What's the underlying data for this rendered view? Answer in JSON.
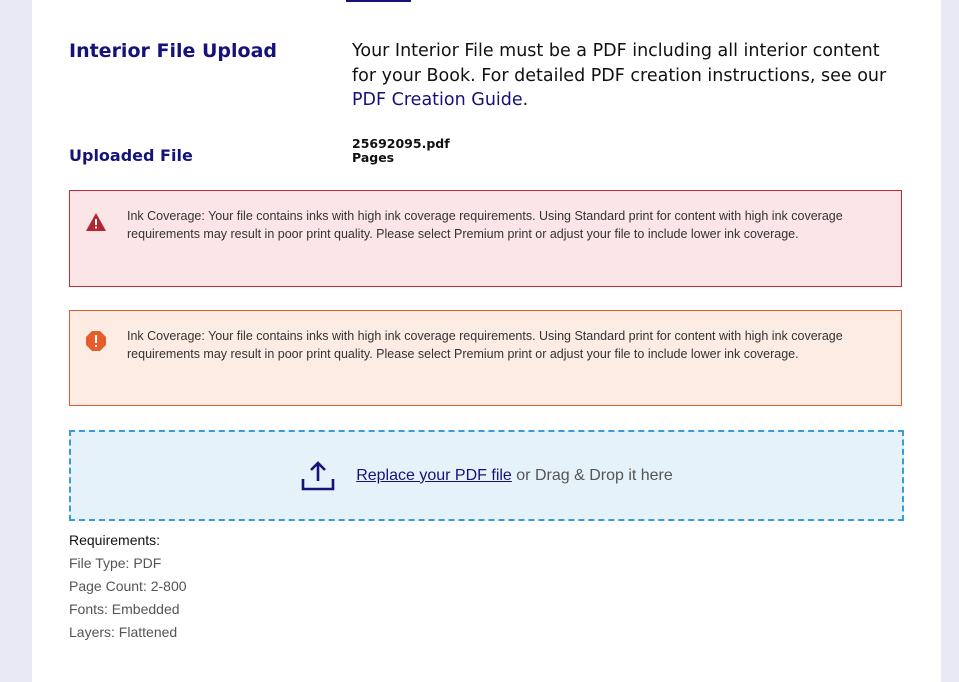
{
  "interior": {
    "heading": "Interior File Upload",
    "intro_text": "Your Interior File must be a PDF including all interior content for your Book. For detailed PDF creation instructions, see our ",
    "guide_link": "PDF Creation Guide",
    "guide_suffix": "."
  },
  "uploaded": {
    "heading": "Uploaded File",
    "filename": "25692095.pdf",
    "pages_label": "Pages"
  },
  "alerts": [
    {
      "severity": "error",
      "icon": "warning-triangle-icon",
      "text": "Ink Coverage: Your file contains inks with high ink coverage requirements. Using Standard print for content with high ink coverage requirements may result in poor print quality. Please select Premium print or adjust your file to include lower ink coverage."
    },
    {
      "severity": "warning",
      "icon": "exclamation-octagon-icon",
      "text": "Ink Coverage: Your file contains inks with high ink coverage requirements. Using Standard print for content with high ink coverage requirements may result in poor print quality. Please select Premium print or adjust your file to include lower ink coverage."
    }
  ],
  "dropzone": {
    "icon": "upload-icon",
    "link_text": "Replace your PDF file",
    "suffix_text": " or Drag & Drop it here"
  },
  "requirements": {
    "title": "Requirements:",
    "items": [
      "File Type: PDF",
      "Page Count: 2-800",
      "Fonts: Embedded",
      "Layers: Flattened"
    ]
  },
  "colors": {
    "brand": "#15127a",
    "error_border": "#c32a36",
    "error_background": "#fbe5e7",
    "warning_border": "#e45d2a",
    "warning_background": "#fdece4",
    "dropzone_border": "#3b9cd4",
    "dropzone_background": "#e6f2fa",
    "page_background": "#e9e9f6"
  }
}
